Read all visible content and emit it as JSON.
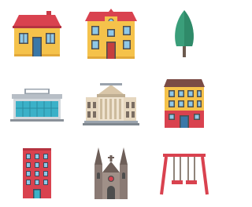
{
  "icons": [
    {
      "name": "house-icon"
    },
    {
      "name": "townhouse-icon"
    },
    {
      "name": "tree-icon"
    },
    {
      "name": "shopping-center-icon"
    },
    {
      "name": "museum-icon"
    },
    {
      "name": "apartment-building-icon"
    },
    {
      "name": "red-apartment-tower-icon"
    },
    {
      "name": "church-icon"
    },
    {
      "name": "swing-icon"
    }
  ],
  "colors": {
    "roof_red": "#d9424f",
    "wall_yellow": "#f5c24b",
    "window_blue": "#3a78a8",
    "door_red": "#c63e3e",
    "tree_green": "#3a9e7a",
    "gray": "#9aa3ad",
    "tan": "#d9c6a8",
    "church_gray": "#8a7a74"
  }
}
